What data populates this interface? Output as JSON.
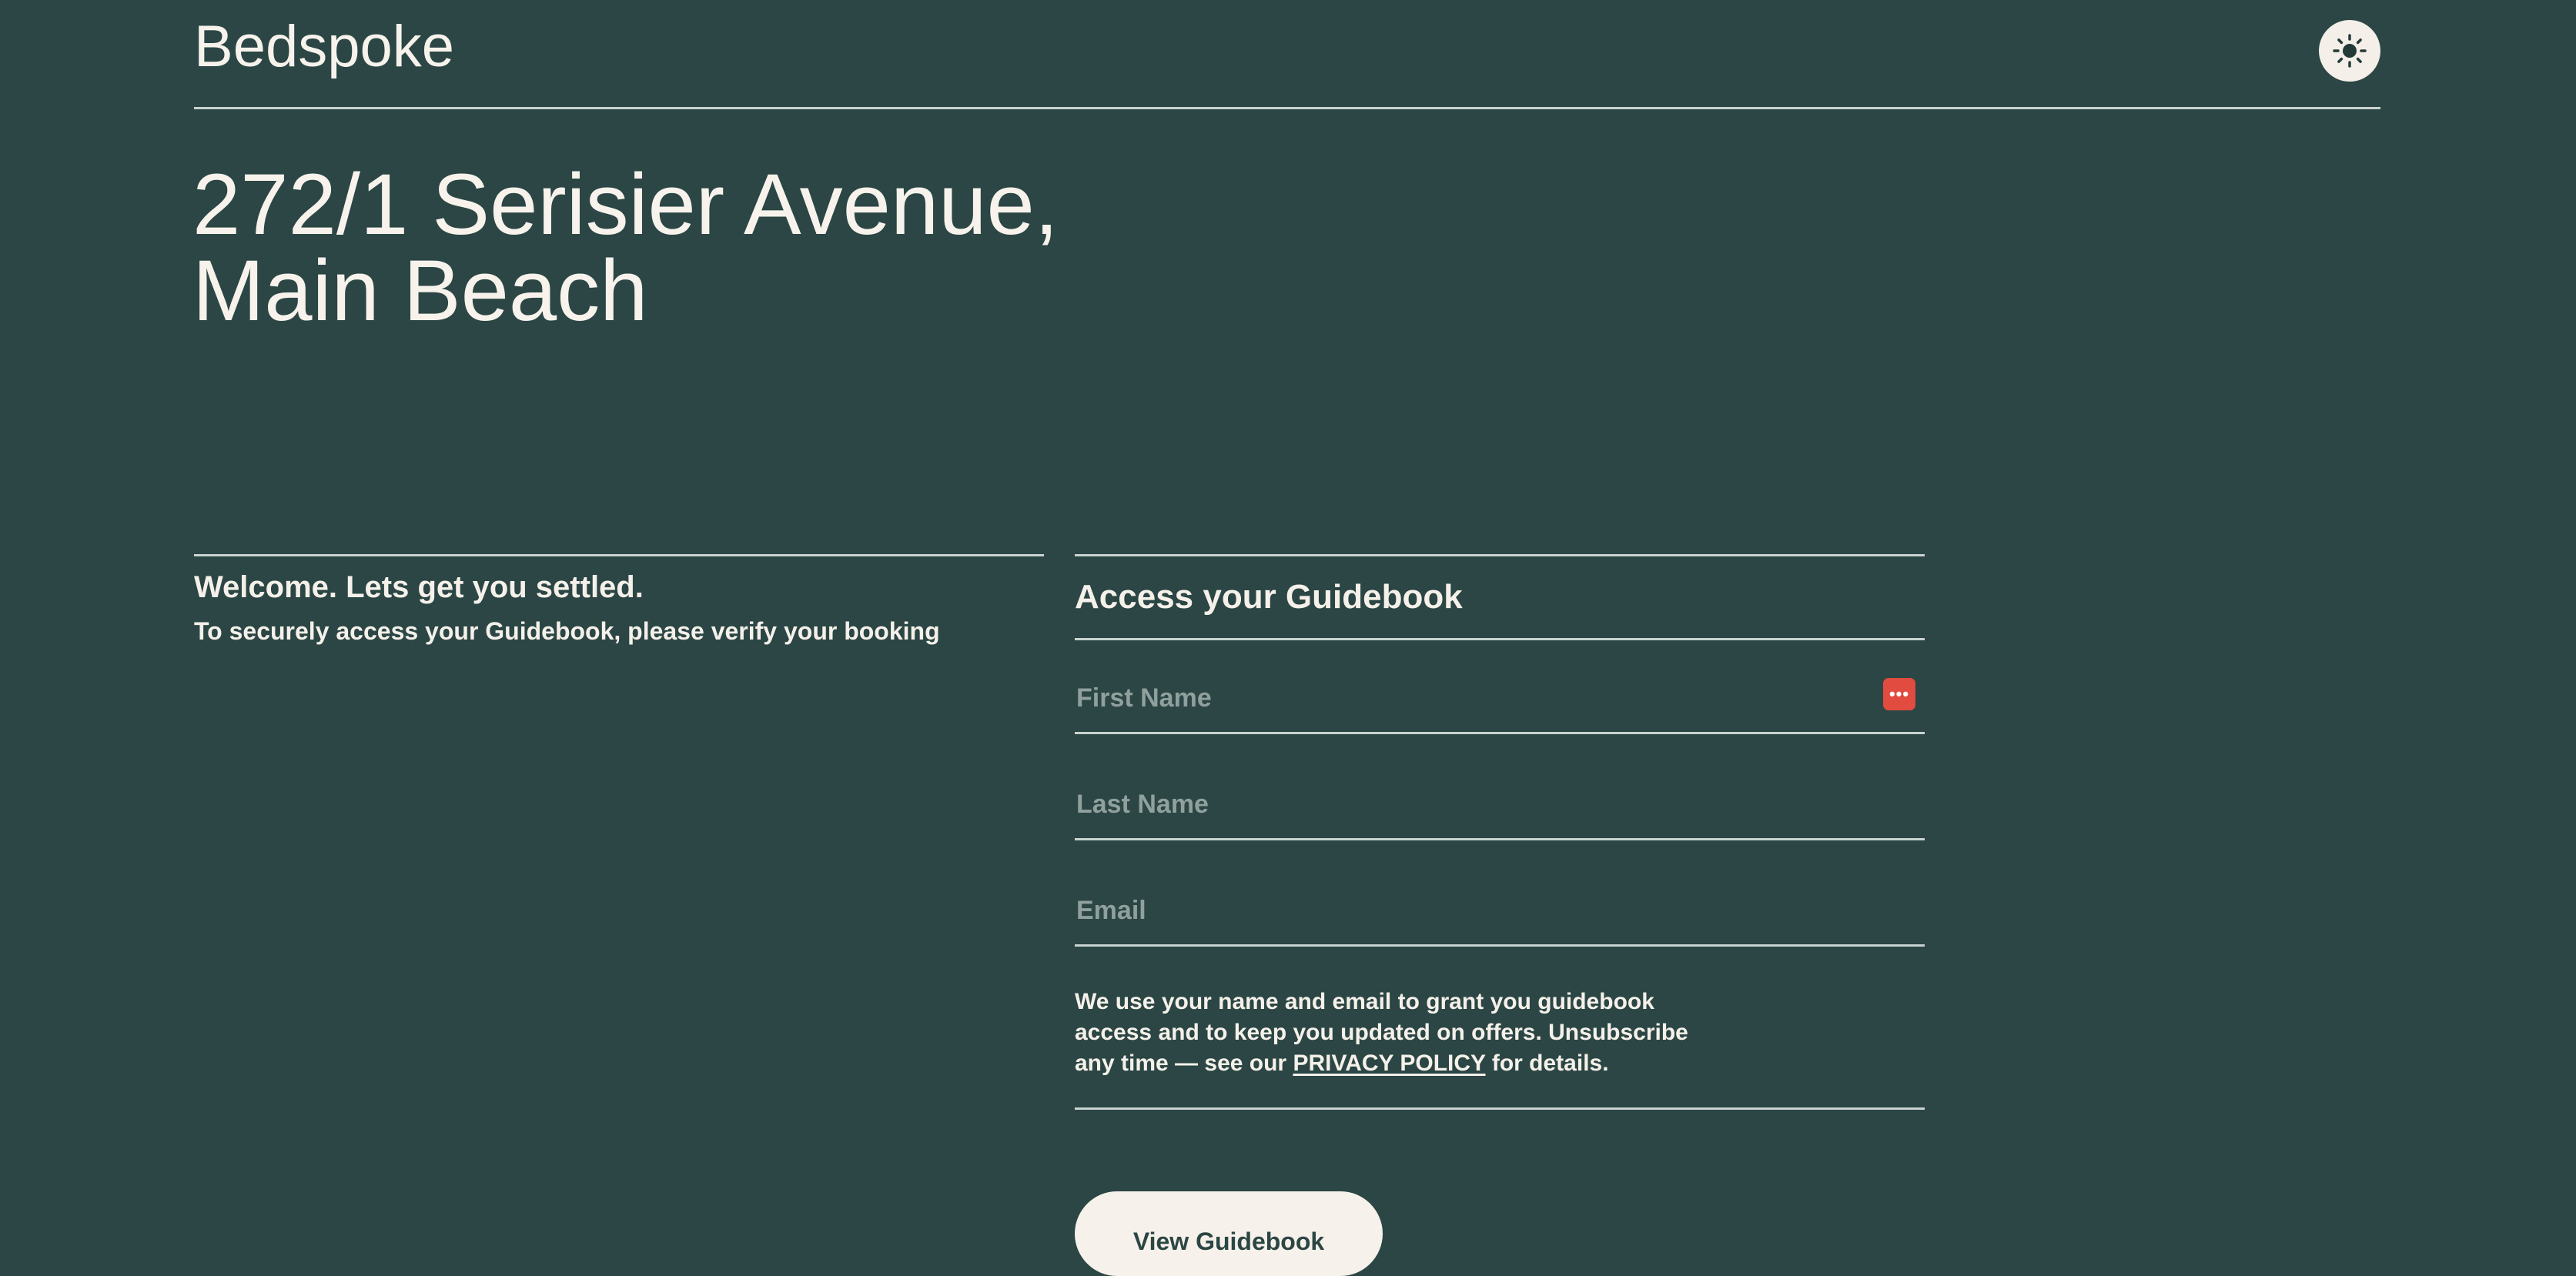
{
  "header": {
    "logo": "Bedspoke",
    "theme_toggle_icon": "sun-icon"
  },
  "property": {
    "address_line1": "272/1 Serisier Avenue,",
    "address_line2": "Main Beach"
  },
  "welcome": {
    "title": "Welcome. Lets get you settled.",
    "subtitle": "To securely access your Guidebook, please verify your booking"
  },
  "form": {
    "title": "Access your Guidebook",
    "first_name_placeholder": "First Name",
    "last_name_placeholder": "Last Name",
    "email_placeholder": "Email",
    "autofill_icon": "password-manager-icon",
    "consent_before": "We use your name and email to grant you guidebook access and to keep you updated on offers. Unsubscribe any time — see our ",
    "privacy_link": "PRIVACY POLICY",
    "consent_after": " for details.",
    "submit_label": "View Guidebook"
  },
  "colors": {
    "background": "#2b4644",
    "text": "#f5f1ea",
    "button_bg": "#f6f1ea",
    "autofill_red": "#e24b3f"
  }
}
